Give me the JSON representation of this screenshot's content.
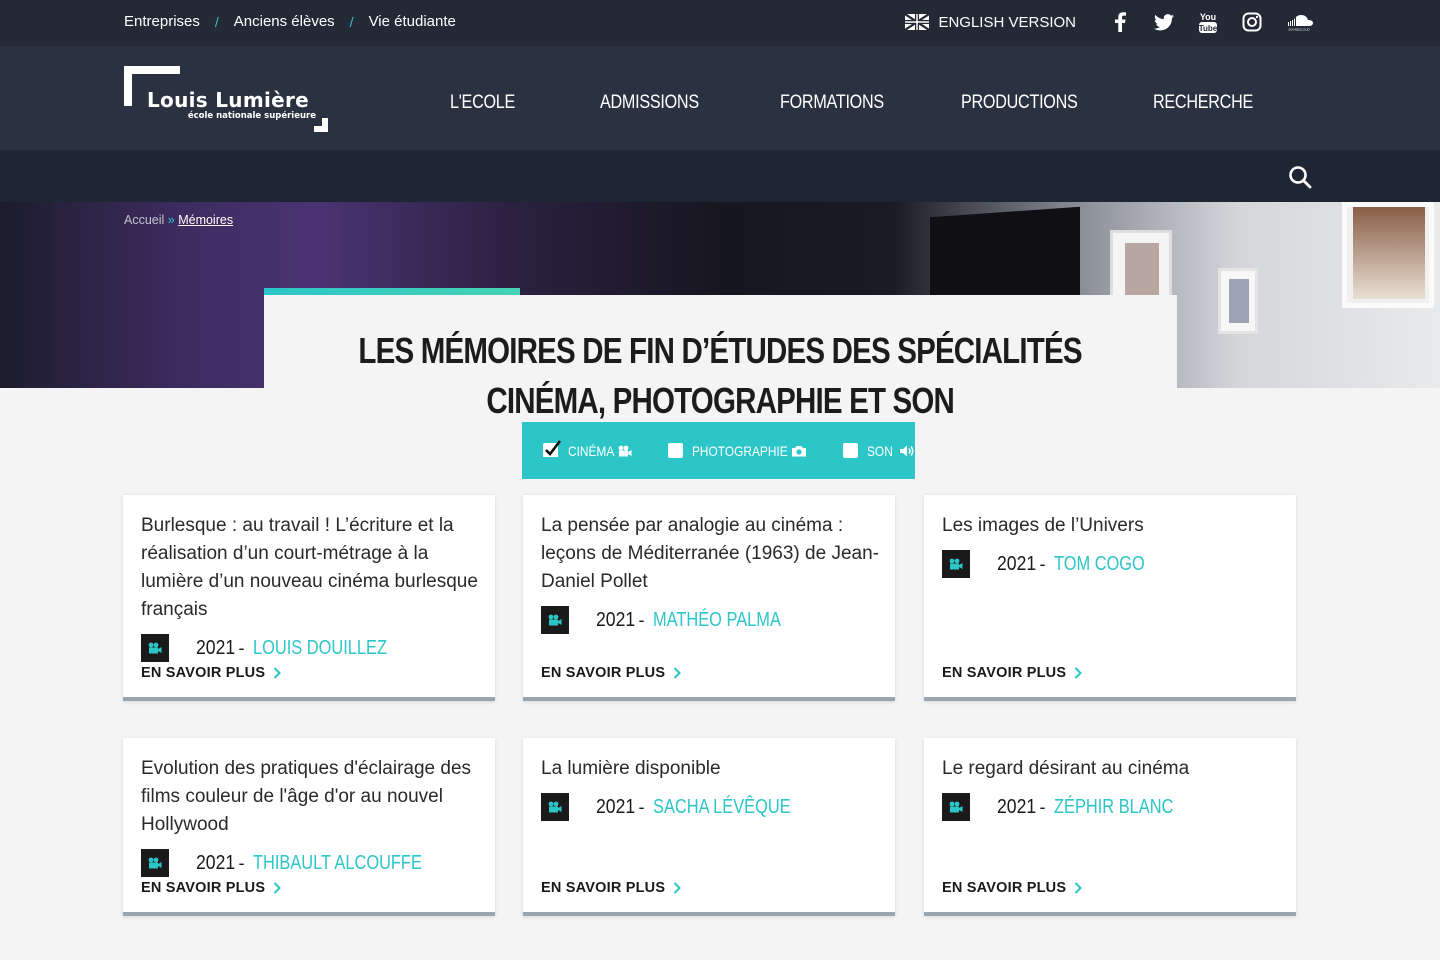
{
  "topbar": {
    "links": [
      "Entreprises",
      "Anciens élèves",
      "Vie étudiante"
    ],
    "separator": "/",
    "lang_label": "ENGLISH VERSION",
    "social": [
      "facebook-icon",
      "twitter-icon",
      "youtube-icon",
      "instagram-icon",
      "soundcloud-icon"
    ]
  },
  "logo": {
    "name": "Louis Lumière",
    "subtitle": "école nationale supérieure"
  },
  "nav": [
    "L'ECOLE",
    "ADMISSIONS",
    "FORMATIONS",
    "PRODUCTIONS",
    "RECHERCHE"
  ],
  "breadcrumb": {
    "home": "Accueil",
    "sep": " » ",
    "current": "Mémoires"
  },
  "page": {
    "title_line1": "LES MÉMOIRES DE FIN D’ÉTUDES DES SPÉCIALITÉS",
    "title_line2": "CINÉMA, PHOTOGRAPHIE ET SON"
  },
  "filters": [
    {
      "label": "CINÉMA",
      "checked": true,
      "icon": "film-camera-icon"
    },
    {
      "label": "PHOTOGRAPHIE",
      "checked": false,
      "icon": "photo-camera-icon"
    },
    {
      "label": "SON",
      "checked": false,
      "icon": "speaker-icon"
    }
  ],
  "cards": [
    {
      "title": "Burlesque : au travail ! L’écriture et la réalisation d’un court-métrage à la lumière d’un nouveau cinéma burlesque français",
      "year": "2021",
      "author": "LOUIS DOUILLEZ",
      "more": "EN SAVOIR PLUS"
    },
    {
      "title": "La pensée par analogie au cinéma : leçons de Méditerranée (1963) de Jean-Daniel Pollet",
      "year": "2021",
      "author": "MATHÉO PALMA",
      "more": "EN SAVOIR PLUS"
    },
    {
      "title": "Les images de l’Univers",
      "year": "2021",
      "author": "TOM COGO",
      "more": "EN SAVOIR PLUS"
    },
    {
      "title": "Evolution des pratiques d'éclairage des films couleur de l'âge d'or au nouvel Hollywood",
      "year": "2021",
      "author": "THIBAULT ALCOUFFE",
      "more": "EN SAVOIR PLUS"
    },
    {
      "title": "La lumière disponible",
      "year": "2021",
      "author": "SACHA LÉVÊQUE",
      "more": "EN SAVOIR PLUS"
    },
    {
      "title": "Le regard désirant au cinéma",
      "year": "2021",
      "author": "ZÉPHIR BLANC",
      "more": "EN SAVOIR PLUS"
    }
  ],
  "colors": {
    "accent": "#2cc6c8",
    "topbar": "#232a36",
    "header": "#2a3242",
    "searchbar": "#1f2633",
    "card_border": "#9aa5b2"
  }
}
